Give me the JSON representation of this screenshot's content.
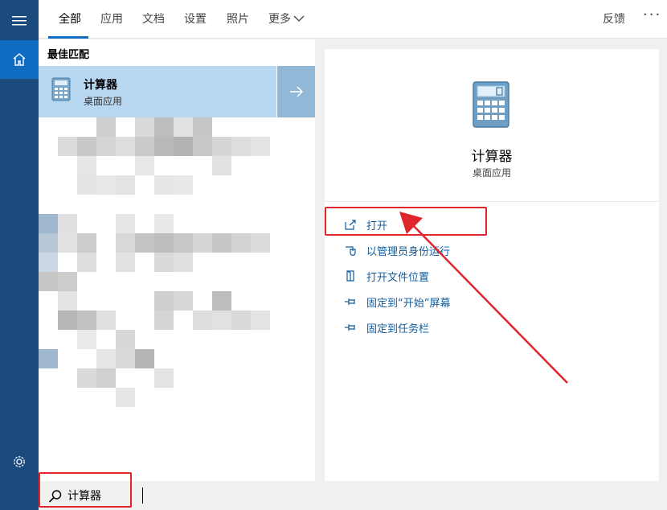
{
  "tabs": [
    {
      "label": "全部",
      "active": true
    },
    {
      "label": "应用",
      "active": false
    },
    {
      "label": "文档",
      "active": false
    },
    {
      "label": "设置",
      "active": false
    },
    {
      "label": "照片",
      "active": false
    },
    {
      "label": "更多",
      "active": false
    }
  ],
  "header": {
    "feedback": "反馈",
    "more_options": "···"
  },
  "results": {
    "section_label": "最佳匹配",
    "best_match": {
      "title": "计算器",
      "subtitle": "桌面应用",
      "icon": "calculator-icon"
    }
  },
  "detail": {
    "title": "计算器",
    "subtitle": "桌面应用",
    "icon": "calculator-icon",
    "actions": [
      {
        "label": "打开",
        "icon": "open-external-icon"
      },
      {
        "label": "以管理员身份运行",
        "icon": "admin-shield-icon"
      },
      {
        "label": "打开文件位置",
        "icon": "file-location-icon"
      },
      {
        "label": "固定到“开始”屏幕",
        "icon": "pin-icon"
      },
      {
        "label": "固定到任务栏",
        "icon": "pin-icon"
      }
    ]
  },
  "search": {
    "value": "计算器",
    "icon": "search-icon"
  },
  "rail": {
    "icons": [
      "hamburger-menu-icon",
      "home-icon",
      "settings-gear-icon"
    ]
  },
  "colors": {
    "rail": "#1b4b7c",
    "accent": "#0f6cc0",
    "selected_row": "#b8d7f0",
    "link": "#0f5c9e",
    "annotation": "#e0262d"
  }
}
